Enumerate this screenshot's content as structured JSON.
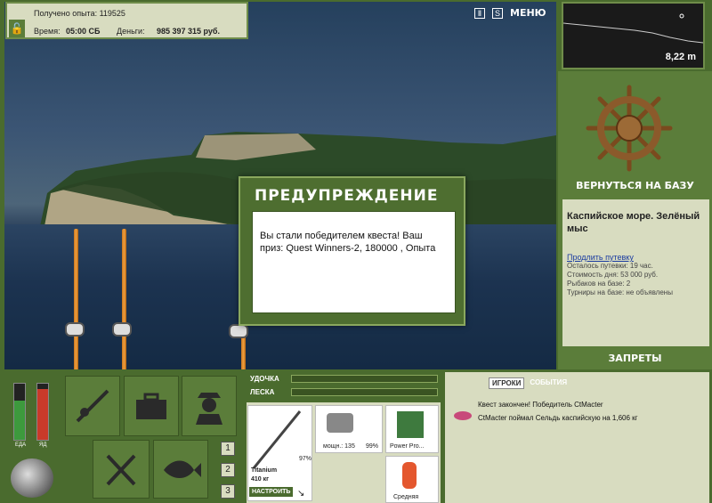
{
  "info": {
    "xp_label": "Получено опыта: 119525",
    "time_label": "Время:",
    "time_value": "05:00 СБ",
    "money_label": "Деньги:",
    "money_value": "985 397 315 руб."
  },
  "top": {
    "menu_label": "МЕНЮ",
    "pause_icon": "pause-icon",
    "skype_icon": "s-icon"
  },
  "dialog": {
    "title": "ПРЕДУПРЕЖДЕНИЕ",
    "text": "Вы стали победителем квеста! Ваш приз: Quest Winners-2, 180000 , Опыта"
  },
  "depth": {
    "value": "8,22 m"
  },
  "right": {
    "back_label": "ВЕРНУТЬСЯ НА БАЗУ",
    "place_name": "Каспийское море. Зелёный мыс",
    "extend_link": "Продлить путевку",
    "left_time": "Осталось путевки: 19 час.",
    "day_cost": "Стоимость дня: 53 000 руб.",
    "fishers": "Рыбаков на базе: 2",
    "tournaments": "Турниры на базе: не объявлены",
    "bans_label": "ЗАПРЕТЫ"
  },
  "gauges": {
    "food_label": "ЕДА",
    "food_level": 0.7,
    "drink_label": "ЯД",
    "drink_level": 0.9
  },
  "nums": [
    "1",
    "2",
    "3"
  ],
  "rod": {
    "rod_label": "УДОЧКА",
    "line_label": "ЛЕСКА",
    "rod_name": "Titanium",
    "rod_weight": "410 кг",
    "rod_pct": "97%",
    "reel_text": "мощн.: 135",
    "reel_pct": "99%",
    "bait_name": "Power Pro...",
    "lure_name": "Средняя",
    "configure_label": "НАСТРОИТЬ"
  },
  "events": {
    "tab_players": "ИГРОКИ",
    "tab_events": "СОБЫТИЯ",
    "line1": "Квест закончен! Победитель CtMacter",
    "line2": "CtMacter поймал Сельдь каспийскую на 1,606 кг"
  }
}
